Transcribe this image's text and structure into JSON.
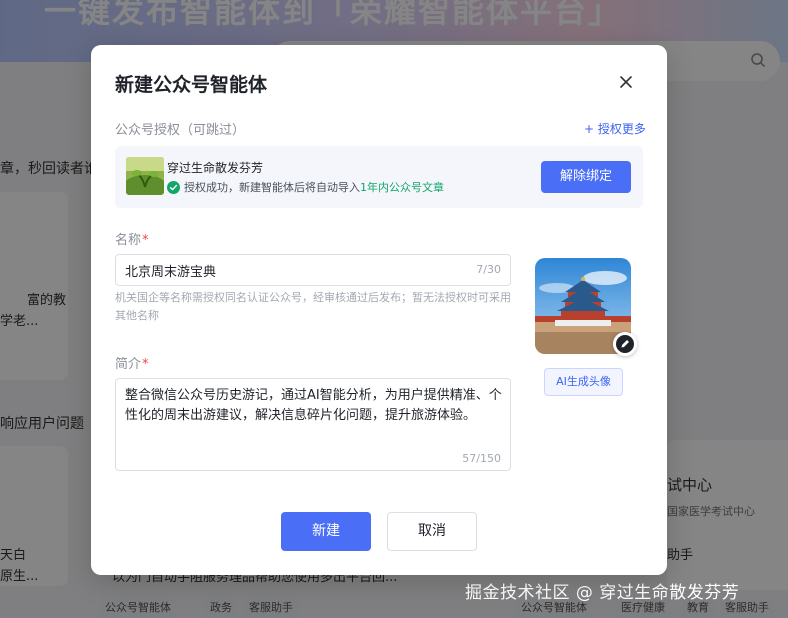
{
  "background": {
    "banner_title": "一键发布智能体到「荣耀智能体平台」",
    "left_heading_1": "章，秒回读者谁",
    "left_card_1_line1": "富的教",
    "left_card_1_line2": "学老...",
    "left_heading_2": "响应用户问题",
    "left_card_2_line1": "天白",
    "left_card_2_line2": "原生...",
    "left_footer_text": "以为门自动手阻服务理品帮助您使用多出平台回...",
    "right_card_title": "试中心",
    "right_card_org": "国家医学考试中心",
    "right_card_desc": "助手",
    "tags_left": [
      "公众号智能体",
      "政务",
      "客服助手"
    ],
    "tags_right": [
      "公众号智能体",
      "医疗健康",
      "教育",
      "客服助手"
    ]
  },
  "modal": {
    "title": "新建公众号智能体",
    "auth_section_label": "公众号授权（可跳过）",
    "auth_more": "+ 授权更多",
    "account_name": "穿过生命散发芬芳",
    "auth_status_prefix": "授权成功，新建智能体后将自动导入",
    "auth_status_highlight": "1年内公众号文章",
    "unbind_button": "解除绑定",
    "name_label": "名称",
    "name_value": "北京周末游宝典",
    "name_counter": "7/30",
    "name_hint": "机关国企等名称需授权同名认证公众号，经审核通过后发布；暂无法授权时可采用其他名称",
    "intro_label": "简介",
    "intro_value": "整合微信公众号历史游记，通过AI智能分析，为用户提供精准、个性化的周末出游建议，解决信息碎片化问题，提升旅游体验。",
    "intro_counter": "57/150",
    "ai_avatar_button": "AI生成头像",
    "create_button": "新建",
    "cancel_button": "取消",
    "required_mark": "*"
  },
  "watermark": "掘金技术社区 @ 穿过生命散发芬芳",
  "colors": {
    "primary": "#4a6ef5",
    "success": "#12a669",
    "required": "#f0473d"
  }
}
